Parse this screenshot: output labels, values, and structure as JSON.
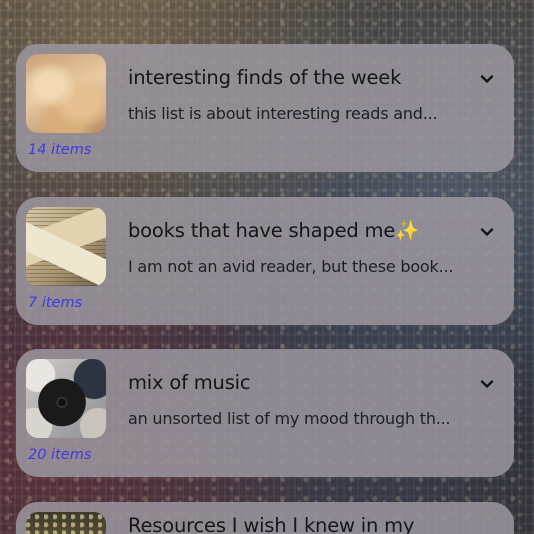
{
  "lists": [
    {
      "title": "interesting finds of the week",
      "description": "this list is about interesting reads and...",
      "count": "14 items",
      "thumbnail_icon": "clouds-image"
    },
    {
      "title": "books that have shaped me",
      "title_suffix": "✨",
      "description": "I am not an avid reader, but these book...",
      "count": "7 items",
      "thumbnail_icon": "books-image"
    },
    {
      "title": "mix of music",
      "description": "an unsorted list of my mood through th...",
      "count": "20 items",
      "thumbnail_icon": "vinyl-records-image"
    },
    {
      "title": "Resources I wish I knew in my",
      "thumbnail_icon": "lights-image"
    }
  ],
  "icons": {
    "expand": "chevron-down-icon"
  },
  "colors": {
    "card_background": "#9b969e",
    "count_text": "#3e3be0",
    "title_text": "#16151a"
  }
}
